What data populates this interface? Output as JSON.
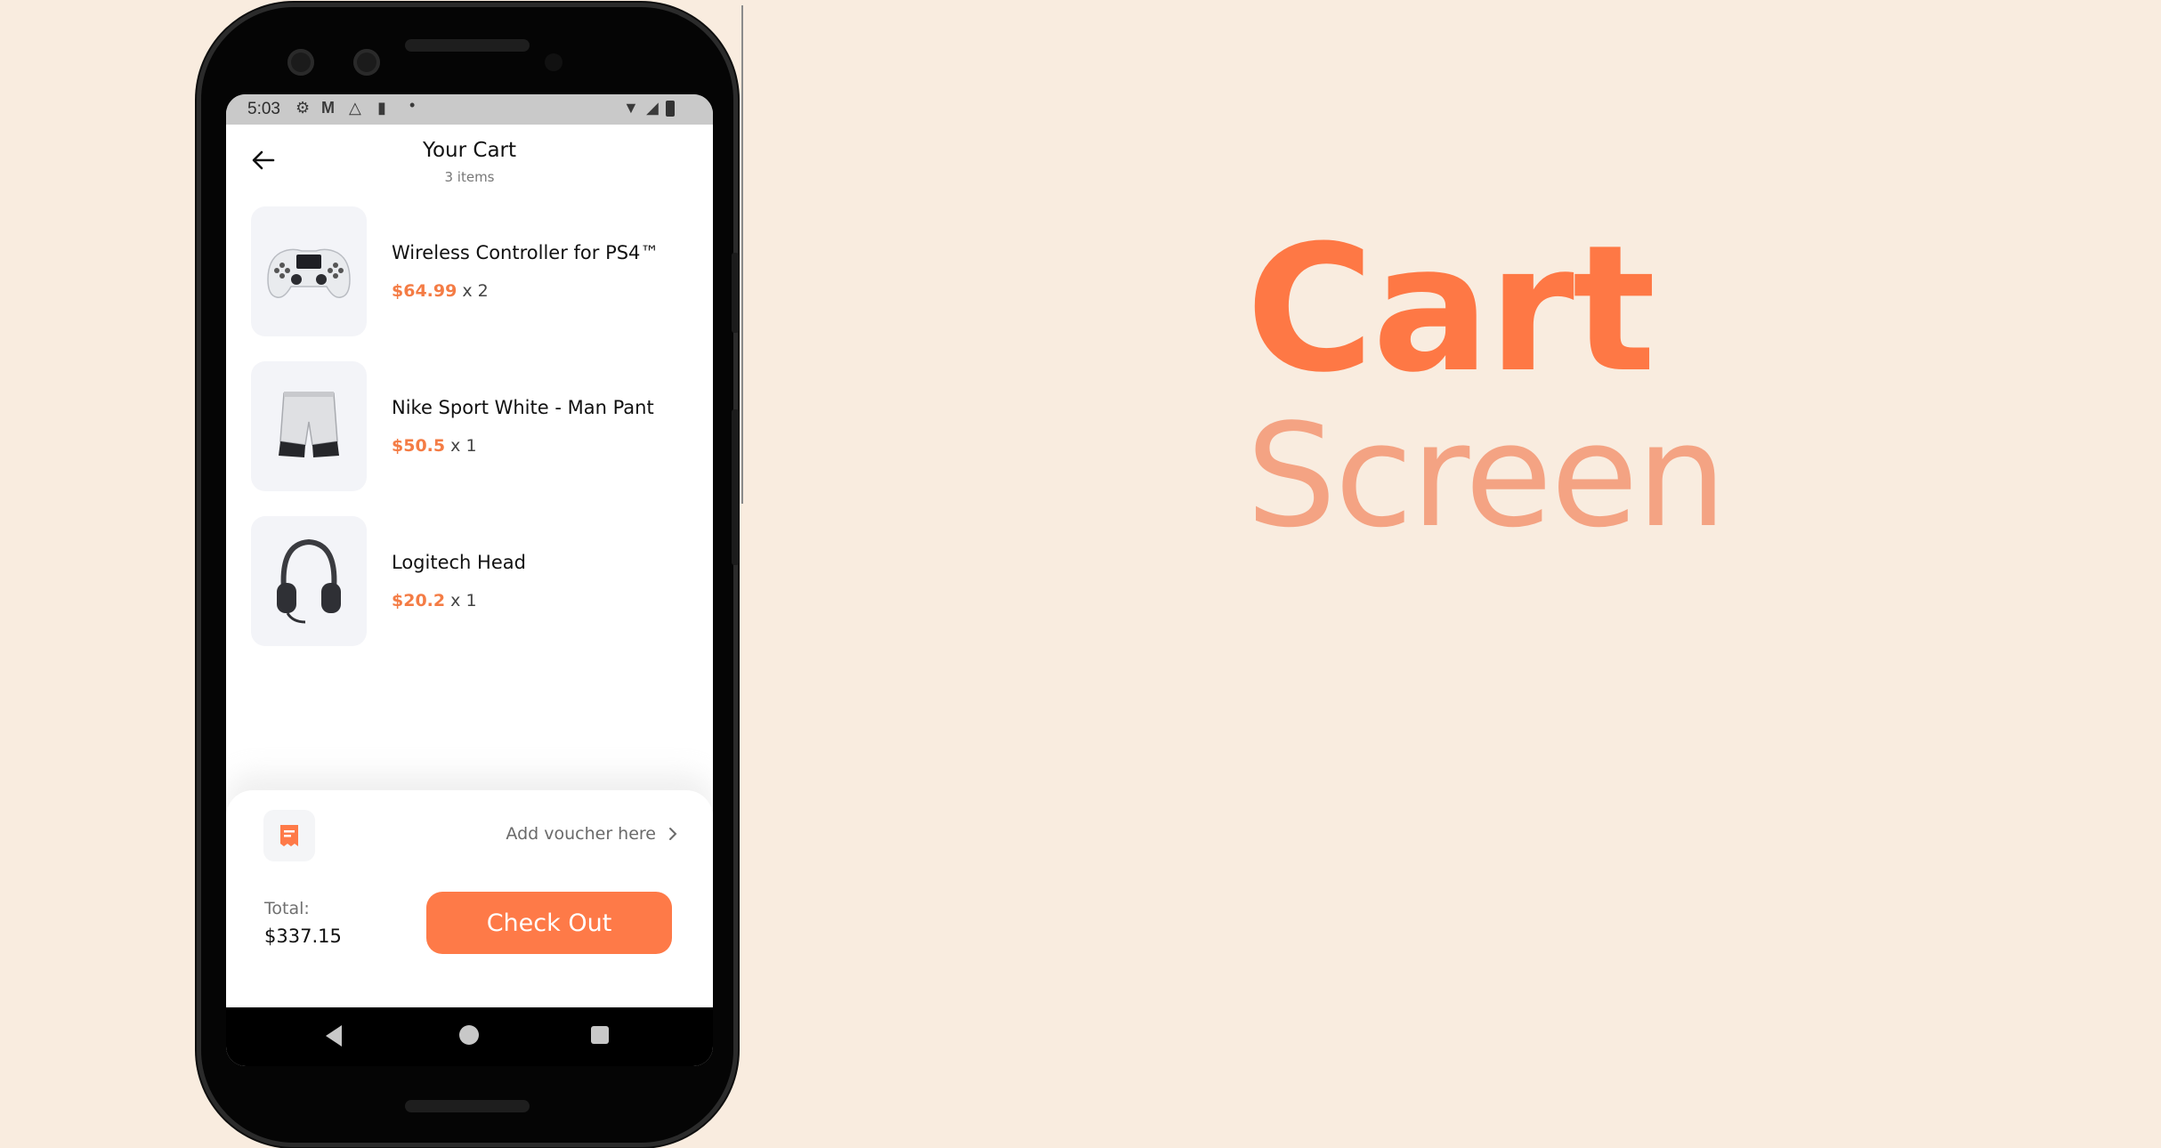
{
  "status_bar": {
    "time": "5:03",
    "icons": [
      "gear-icon",
      "gmail-icon",
      "drive-icon",
      "sd-card-icon",
      "dot-icon",
      "wifi-icon",
      "signal-icon",
      "battery-icon"
    ]
  },
  "header": {
    "title": "Your Cart",
    "subtitle": "3 items"
  },
  "cart_items": [
    {
      "name": "Wireless Controller for PS4™",
      "price": "$64.99",
      "quantity": "x 2",
      "icon": "gamepad-icon"
    },
    {
      "name": "Nike Sport White - Man Pant",
      "price": "$50.5",
      "quantity": "x 1",
      "icon": "shorts-icon"
    },
    {
      "name": "Logitech Head",
      "price": "$20.2",
      "quantity": "x 1",
      "icon": "headphones-icon"
    }
  ],
  "checkout": {
    "voucher_label": "Add voucher here",
    "total_label": "Total:",
    "total_value": "$337.15",
    "button_label": "Check Out"
  },
  "promo": {
    "title": "Cart",
    "subtitle": "Screen"
  },
  "colors": {
    "background": "#f9ecdf",
    "accent": "#fe7a48",
    "accent_light": "#f4a383",
    "price": "#f47c45"
  }
}
